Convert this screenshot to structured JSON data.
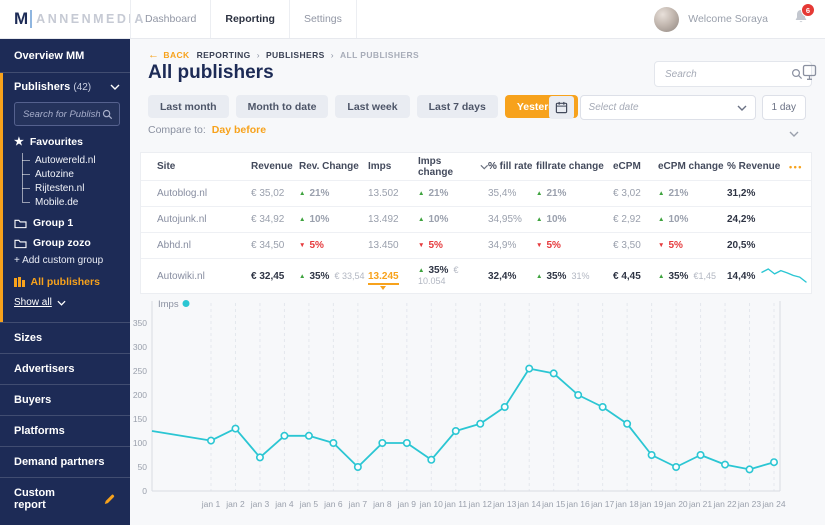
{
  "colors": {
    "accent_orange": "#f7a21c",
    "navy": "#1d2b56",
    "teal": "#2bc6d3",
    "green": "#3fa33f",
    "red": "#e5393c"
  },
  "icons": {
    "trend_up": "▲",
    "trend_down": "▼",
    "star": "★",
    "back_arrow": "←",
    "breadcrumb_separator": "›",
    "more": "•••"
  },
  "topbar": {
    "logo_mark": "M",
    "logo_text": "ANNENMEDIA",
    "tabs": [
      {
        "label": "Dashboard",
        "active": false
      },
      {
        "label": "Reporting",
        "active": true
      },
      {
        "label": "Settings",
        "active": false
      }
    ],
    "welcome": "Welcome Soraya",
    "badge": "6"
  },
  "sidebar": {
    "overview": "Overview MM",
    "publishers_label": "Publishers",
    "publishers_count": "(42)",
    "search_placeholder": "Search for Publishers",
    "favourites_label": "Favourites",
    "favourites": [
      "Autowereld.nl",
      "Autozine",
      "Rijtesten.nl",
      "Mobile.de"
    ],
    "groups": [
      "Group 1",
      "Group zozo"
    ],
    "add_group": "+ Add custom group",
    "all_publishers": "All publishers",
    "show_all": "Show all",
    "sections": [
      "Sizes",
      "Advertisers",
      "Buyers",
      "Platforms",
      "Demand partners"
    ],
    "custom_report": "Custom report"
  },
  "header": {
    "back": "BACK",
    "breadcrumb": [
      "REPORTING",
      "PUBLISHERS",
      "ALL PUBLISHERS"
    ],
    "title": "All publishers",
    "search_placeholder": "Search"
  },
  "filters": {
    "presets": [
      "Last month",
      "Month to date",
      "Last week",
      "Last 7 days",
      "Yesterday"
    ],
    "active_index": 4,
    "compare_label": "Compare to:",
    "compare_value": "Day before",
    "select_date": "Select date",
    "duration": "1 day"
  },
  "table": {
    "columns": [
      {
        "label": "Site"
      },
      {
        "label": "Revenue"
      },
      {
        "label": "Rev. Change"
      },
      {
        "label": "Imps"
      },
      {
        "label": "Imps change",
        "sort": true
      },
      {
        "label": "% fill rate"
      },
      {
        "label": "fillrate change"
      },
      {
        "label": "eCPM"
      },
      {
        "label": "eCPM change"
      },
      {
        "label": "% Revenue"
      }
    ],
    "more_label": "•••",
    "rows": [
      {
        "site": "Autoblog.nl",
        "revenue": "€ 35,02",
        "rev_change": {
          "dir": "up",
          "pct": "21%"
        },
        "imps": "13.502",
        "imps_change": {
          "dir": "up",
          "pct": "21%"
        },
        "fill_rate": "35,4%",
        "fillrate_change": {
          "dir": "up",
          "pct": "21%"
        },
        "ecpm": "€ 3,02",
        "ecpm_change": {
          "dir": "up",
          "pct": "21%"
        },
        "revenue_pct": "31,2%",
        "highlight": false
      },
      {
        "site": "Autojunk.nl",
        "revenue": "€ 34,92",
        "rev_change": {
          "dir": "up",
          "pct": "10%"
        },
        "imps": "13.492",
        "imps_change": {
          "dir": "up",
          "pct": "10%"
        },
        "fill_rate": "34,95%",
        "fillrate_change": {
          "dir": "up",
          "pct": "10%"
        },
        "ecpm": "€ 2,92",
        "ecpm_change": {
          "dir": "up",
          "pct": "10%"
        },
        "revenue_pct": "24,2%",
        "highlight": false
      },
      {
        "site": "Abhd.nl",
        "revenue": "€ 34,50",
        "rev_change": {
          "dir": "down",
          "pct": "5%"
        },
        "imps": "13.450",
        "imps_change": {
          "dir": "down",
          "pct": "5%"
        },
        "fill_rate": "34,9%",
        "fillrate_change": {
          "dir": "down",
          "pct": "5%"
        },
        "ecpm": "€ 3,50",
        "ecpm_change": {
          "dir": "down",
          "pct": "5%"
        },
        "revenue_pct": "20,5%",
        "highlight": false
      },
      {
        "site": "Autowiki.nl",
        "revenue": "€ 32,45",
        "rev_change": {
          "dir": "up",
          "pct": "35%",
          "extra": "€ 33,54"
        },
        "imps": "13.245",
        "imps_highlight": true,
        "imps_change": {
          "dir": "up",
          "pct": "35%",
          "extra": "€ 10.054"
        },
        "fill_rate": "32,4%",
        "fillrate_change": {
          "dir": "up",
          "pct": "35%",
          "extra": "31%"
        },
        "ecpm": "€ 4,45",
        "ecpm_change": {
          "dir": "up",
          "pct": "35%",
          "extra": "€1,45"
        },
        "revenue_pct": "14,4%",
        "highlight": true,
        "sparkline": [
          60,
          70,
          55,
          65,
          58,
          50,
          45,
          30
        ]
      }
    ]
  },
  "chart_data": {
    "type": "line",
    "series_label": "Imps",
    "color": "#2bc6d3",
    "x": [
      "jan 1",
      "jan 2",
      "jan 3",
      "jan 4",
      "jan 5",
      "jan 6",
      "jan 7",
      "jan 8",
      "jan 9",
      "jan 10",
      "jan 11",
      "jan 12",
      "jan 13",
      "jan 14",
      "jan 15",
      "jan 16",
      "jan 17",
      "jan 18",
      "jan 19",
      "jan 20",
      "jan 21",
      "jan 22",
      "jan 23",
      "jan 24"
    ],
    "values": [
      105,
      130,
      70,
      115,
      115,
      100,
      50,
      100,
      100,
      65,
      125,
      140,
      175,
      255,
      245,
      200,
      175,
      140,
      75,
      50,
      75,
      55,
      45,
      60
    ],
    "edge_start_value": 125,
    "ylim": [
      0,
      400
    ],
    "yticks": [
      0,
      50,
      100,
      150,
      200,
      250,
      300,
      350
    ],
    "grid": "vertical-dashed",
    "legend_position": "top-left"
  }
}
